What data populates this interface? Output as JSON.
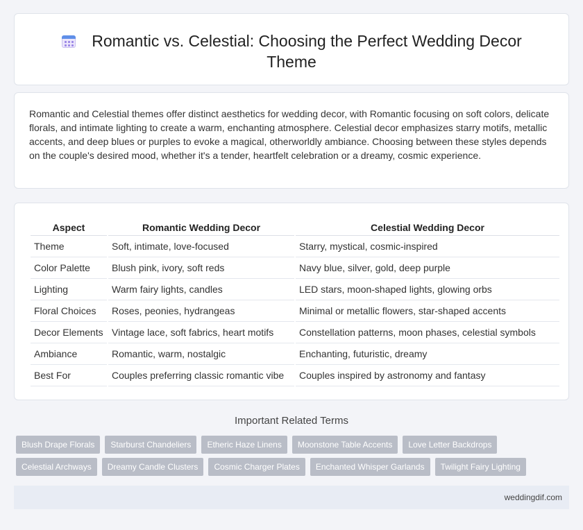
{
  "header": {
    "title": "Romantic vs. Celestial: Choosing the Perfect Wedding Decor Theme",
    "icon": "calendar-icon"
  },
  "intro": {
    "text": "Romantic and Celestial themes offer distinct aesthetics for wedding decor, with Romantic focusing on soft colors, delicate florals, and intimate lighting to create a warm, enchanting atmosphere. Celestial decor emphasizes starry motifs, metallic accents, and deep blues or purples to evoke a magical, otherworldly ambiance. Choosing between these styles depends on the couple's desired mood, whether it's a tender, heartfelt celebration or a dreamy, cosmic experience."
  },
  "table": {
    "headers": [
      "Aspect",
      "Romantic Wedding Decor",
      "Celestial Wedding Decor"
    ],
    "rows": [
      [
        "Theme",
        "Soft, intimate, love-focused",
        "Starry, mystical, cosmic-inspired"
      ],
      [
        "Color Palette",
        "Blush pink, ivory, soft reds",
        "Navy blue, silver, gold, deep purple"
      ],
      [
        "Lighting",
        "Warm fairy lights, candles",
        "LED stars, moon-shaped lights, glowing orbs"
      ],
      [
        "Floral Choices",
        "Roses, peonies, hydrangeas",
        "Minimal or metallic flowers, star-shaped accents"
      ],
      [
        "Decor Elements",
        "Vintage lace, soft fabrics, heart motifs",
        "Constellation patterns, moon phases, celestial symbols"
      ],
      [
        "Ambiance",
        "Romantic, warm, nostalgic",
        "Enchanting, futuristic, dreamy"
      ],
      [
        "Best For",
        "Couples preferring classic romantic vibe",
        "Couples inspired by astronomy and fantasy"
      ]
    ]
  },
  "terms": {
    "heading": "Important Related Terms",
    "row1": [
      "Blush Drape Florals",
      "Starburst Chandeliers",
      "Etheric Haze Linens",
      "Moonstone Table Accents",
      "Love Letter Backdrops"
    ],
    "row2": [
      "Celestial Archways",
      "Dreamy Candle Clusters",
      "Cosmic Charger Plates",
      "Enchanted Whisper Garlands",
      "Twilight Fairy Lighting"
    ]
  },
  "footer": {
    "site": "weddingdif.com"
  },
  "colors": {
    "background": "#f3f4f8",
    "tag": "#b9bdc7",
    "footer": "#e8ecf4"
  }
}
